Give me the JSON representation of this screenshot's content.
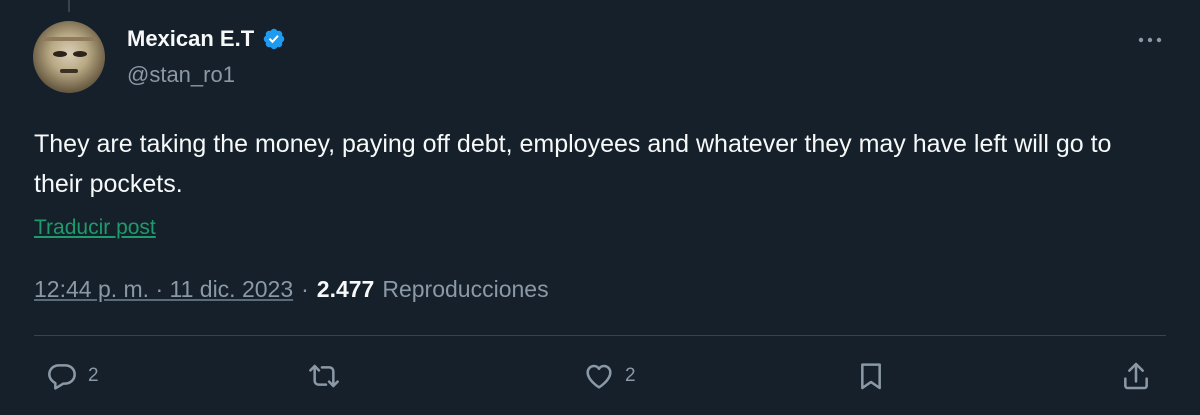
{
  "author": {
    "display_name": "Mexican E.T",
    "handle": "@stan_ro1",
    "verified": true
  },
  "tweet": {
    "text": "They are taking the money, paying off debt, employees and whatever they may have left will go to their pockets.",
    "translate_label": "Traducir post",
    "time": "12:44 p. m. · 11 dic. 2023",
    "separator": "·",
    "views_count": "2.477",
    "views_label": "Reproducciones"
  },
  "actions": {
    "reply_count": "2",
    "like_count": "2"
  },
  "icons": {
    "more": "more-horizontal-icon",
    "verified": "verified-badge-icon",
    "reply": "reply-icon",
    "retweet": "retweet-icon",
    "like": "heart-icon",
    "bookmark": "bookmark-icon",
    "share": "share-icon"
  },
  "colors": {
    "background": "#15202b",
    "text": "#f7f9f9",
    "secondary": "#8b98a5",
    "verified": "#1d9bf0",
    "translate_link": "#1d9b6a"
  }
}
